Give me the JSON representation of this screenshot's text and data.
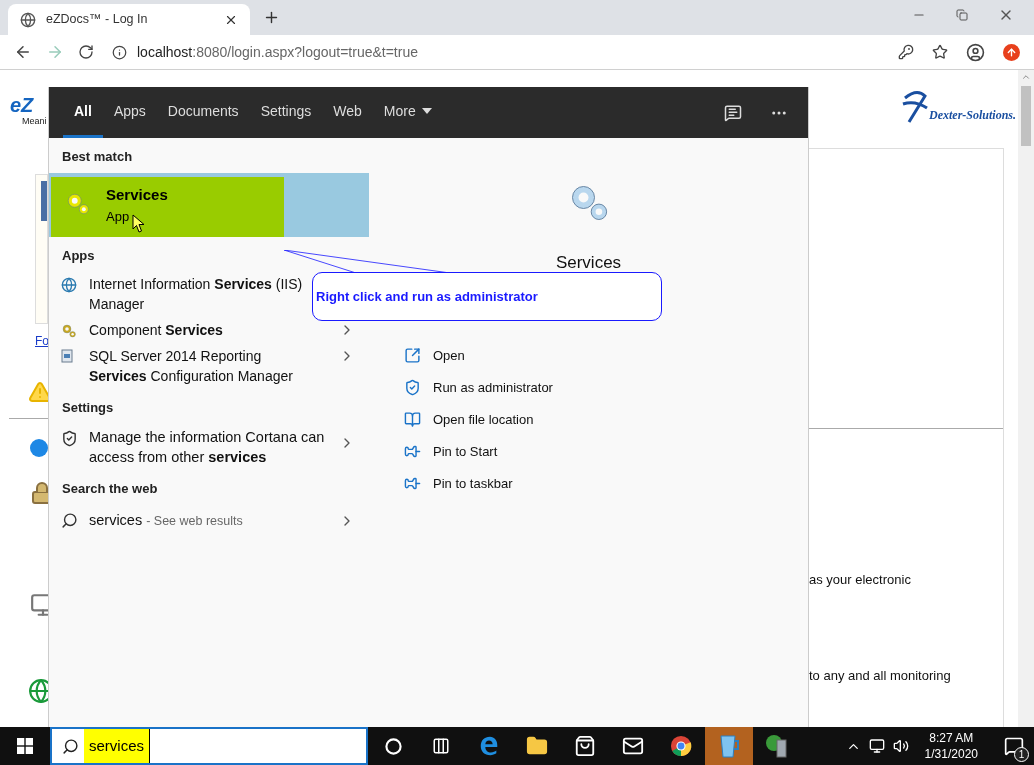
{
  "browser": {
    "tab_title": "eZDocs™ - Log In",
    "url_host": "localhost",
    "url_rest": ":8080/login.aspx?logout=true&t=true"
  },
  "page": {
    "logo_text": "eZ",
    "tagline": "Meani",
    "link": "Fo",
    "partner_logo": "Dexter-Solutions.",
    "text_lines": [
      "as your electronic",
      "to any and all monitoring"
    ]
  },
  "search": {
    "tabs": [
      {
        "label": "All",
        "selected": true
      },
      {
        "label": "Apps",
        "selected": false
      },
      {
        "label": "Documents",
        "selected": false
      },
      {
        "label": "Settings",
        "selected": false
      },
      {
        "label": "Web",
        "selected": false
      },
      {
        "label": "More",
        "selected": false
      }
    ],
    "sections": [
      {
        "heading": "Best match",
        "items": [
          {
            "kind": "best",
            "title": "Services",
            "subtitle": "App",
            "selected": true
          }
        ]
      },
      {
        "heading": "Apps",
        "items": [
          {
            "kind": "app",
            "text": "Internet Information **Services** (IIS) Manager"
          },
          {
            "kind": "app",
            "text": "Component **Services**",
            "arrow": true
          },
          {
            "kind": "app",
            "text": "SQL Server 2014 Reporting **Services** Configuration Manager",
            "arrow": true
          }
        ]
      },
      {
        "heading": "Settings",
        "items": [
          {
            "kind": "setting",
            "text": "Manage the information Cortana can access from other **services**",
            "arrow": true
          }
        ]
      },
      {
        "heading": "Search the web",
        "items": [
          {
            "kind": "web",
            "query": "services",
            "hint": "- See web results",
            "arrow": true
          }
        ]
      }
    ],
    "preview": {
      "title": "Services",
      "actions": [
        {
          "kind": "open",
          "label": "Open"
        },
        {
          "kind": "admin",
          "label": "Run as administrator"
        },
        {
          "kind": "location",
          "label": "Open file location"
        },
        {
          "kind": "pin",
          "label": "Pin to Start"
        },
        {
          "kind": "pin",
          "label": "Pin to taskbar"
        }
      ]
    },
    "callout": {
      "text": "Right click and run as administrator"
    },
    "search_box": {
      "value": "services"
    }
  },
  "taskbar": {
    "apps": [
      {
        "kind": "cortana",
        "active": false
      },
      {
        "kind": "taskview",
        "active": false
      },
      {
        "kind": "edge",
        "active": false
      },
      {
        "kind": "explorer",
        "active": false
      },
      {
        "kind": "store",
        "active": false
      },
      {
        "kind": "mail",
        "active": false
      },
      {
        "kind": "chrome",
        "active": false
      },
      {
        "kind": "cup",
        "active": true
      },
      {
        "kind": "server",
        "active": false
      }
    ],
    "time": "8:27 AM",
    "date": "1/31/2020",
    "notifications": "1"
  }
}
